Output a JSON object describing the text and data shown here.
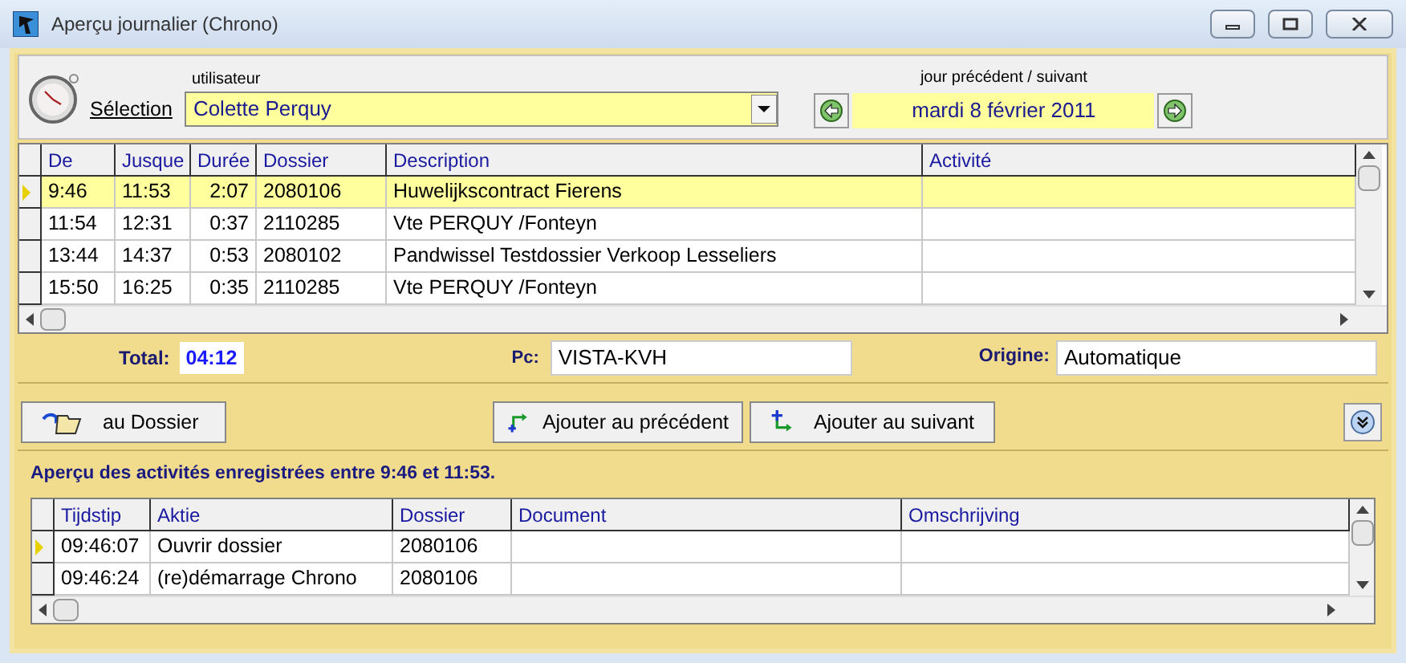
{
  "window": {
    "title": "Aperçu journalier (Chrono)"
  },
  "selection": {
    "label": "Sélection",
    "user_caption": "utilisateur",
    "user": "Colette Perquy",
    "day_caption": "jour précédent / suivant",
    "day": "mardi 8 février 2011"
  },
  "table": {
    "columns": [
      "De",
      "Jusque",
      "Durée",
      "Dossier",
      "Description",
      "Activité"
    ],
    "rows": [
      {
        "selected": true,
        "cells": [
          "9:46",
          "11:53",
          "2:07",
          "2080106",
          "Huwelijkscontract Fierens",
          ""
        ]
      },
      {
        "selected": false,
        "cells": [
          "11:54",
          "12:31",
          "0:37",
          "2110285",
          "Vte  PERQUY /Fonteyn",
          ""
        ]
      },
      {
        "selected": false,
        "cells": [
          "13:44",
          "14:37",
          "0:53",
          "2080102",
          "Pandwissel Testdossier Verkoop Lesseliers",
          ""
        ]
      },
      {
        "selected": false,
        "cells": [
          "15:50",
          "16:25",
          "0:35",
          "2110285",
          "Vte  PERQUY /Fonteyn",
          ""
        ]
      }
    ]
  },
  "totals": {
    "total_label": "Total:",
    "total": "04:12",
    "pc_label": "Pc:",
    "pc": "VISTA-KVH",
    "origin_label": "Origine:",
    "origin": "Automatique"
  },
  "buttons": {
    "dossier": "au Dossier",
    "previous": "Ajouter au précédent",
    "next": "Ajouter au suivant"
  },
  "activities": {
    "title": "Aperçu des activités enregistrées entre 9:46 et 11:53.",
    "columns": [
      "Tijdstip",
      "Aktie",
      "Dossier",
      "Document",
      "Omschrijving"
    ],
    "rows": [
      {
        "selected": true,
        "cells": [
          "09:46:07",
          "Ouvrir dossier",
          "2080106",
          "",
          ""
        ]
      },
      {
        "selected": false,
        "cells": [
          "09:46:24",
          "(re)démarrage Chrono",
          "2080106",
          "",
          ""
        ]
      }
    ]
  }
}
